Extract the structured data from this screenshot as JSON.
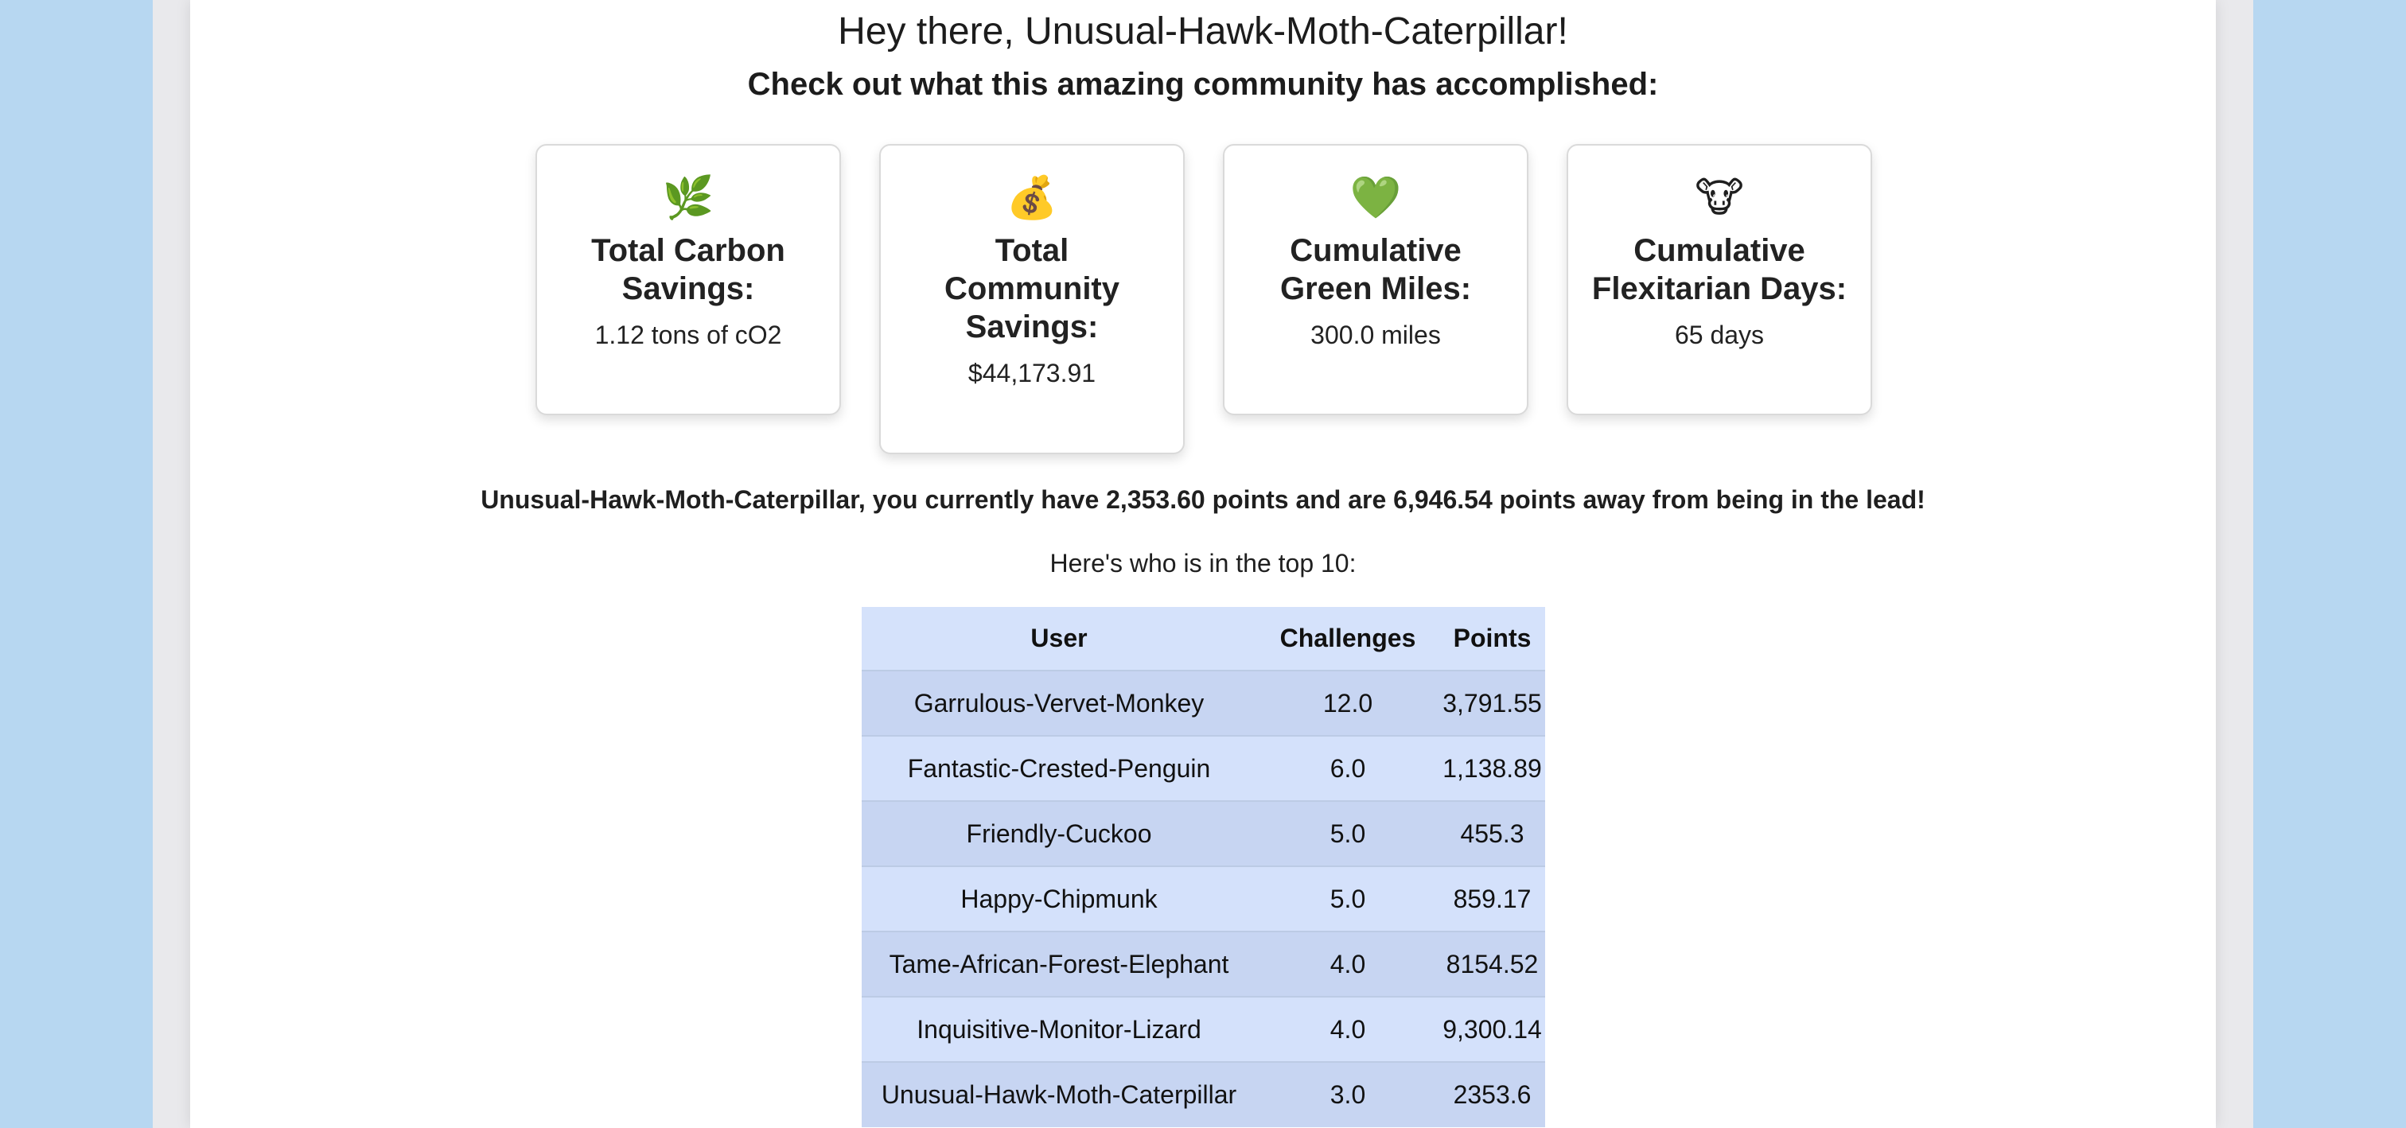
{
  "greeting": "Hey there, Unusual-Hawk-Moth-Caterpillar!",
  "subheading": "Check out what this amazing community has accomplished:",
  "stats": [
    {
      "icon": "🌿",
      "icon_name": "herb-icon",
      "title": "Total Carbon Savings:",
      "value": "1.12 tons of cO2"
    },
    {
      "icon": "💰",
      "icon_name": "money-bag-icon",
      "title": "Total Community Savings:",
      "value": "$44,173.91"
    },
    {
      "icon": "💚",
      "icon_name": "green-heart-icon",
      "title": "Cumulative Green Miles:",
      "value": "300.0 miles"
    },
    {
      "icon": "🐮",
      "icon_name": "cow-face-icon",
      "title": "Cumulative Flexitarian Days:",
      "value": "65 days"
    }
  ],
  "status_message": "Unusual-Hawk-Moth-Caterpillar, you currently have 2,353.60 points and are 6,946.54 points away from being in the lead!",
  "leaderboard": {
    "label": "Here's who is in the top 10:",
    "headers": {
      "user": "User",
      "challenges": "Challenges",
      "points": "Points"
    },
    "rows": [
      {
        "user": "Garrulous-Vervet-Monkey",
        "challenges": "12.0",
        "points": "3,791.55"
      },
      {
        "user": "Fantastic-Crested-Penguin",
        "challenges": "6.0",
        "points": "1,138.89"
      },
      {
        "user": "Friendly-Cuckoo",
        "challenges": "5.0",
        "points": "455.3"
      },
      {
        "user": "Happy-Chipmunk",
        "challenges": "5.0",
        "points": "859.17"
      },
      {
        "user": "Tame-African-Forest-Elephant",
        "challenges": "4.0",
        "points": "8154.52"
      },
      {
        "user": "Inquisitive-Monitor-Lizard",
        "challenges": "4.0",
        "points": "9,300.14"
      },
      {
        "user": "Unusual-Hawk-Moth-Caterpillar",
        "challenges": "3.0",
        "points": "2353.6"
      }
    ]
  },
  "colors": {
    "background": "#b7d7f1",
    "table_header": "#d5e2fb",
    "table_row_odd": "#c7d5f2",
    "table_row_even": "#d4e1fb"
  }
}
